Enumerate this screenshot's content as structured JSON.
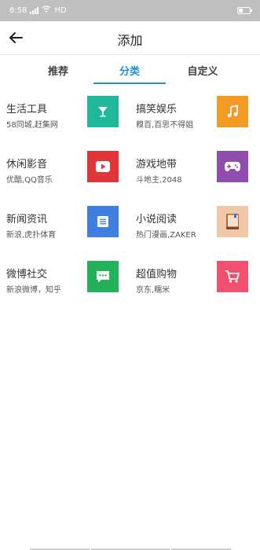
{
  "status": {
    "time": "8:58",
    "network": "HD"
  },
  "header": {
    "title": "添加"
  },
  "tabs": [
    {
      "label": "推荐",
      "active": false
    },
    {
      "label": "分类",
      "active": true
    },
    {
      "label": "自定义",
      "active": false
    }
  ],
  "colors": {
    "accent": "#1e8fd8"
  },
  "categories": [
    {
      "name": "生活工具",
      "desc": "58同城,赶集网",
      "icon": "cocktail-glass-icon",
      "color": "#1fb99a"
    },
    {
      "name": "搞笑娱乐",
      "desc": "糗百,百思不得姐",
      "icon": "music-note-icon",
      "color": "#f39a24"
    },
    {
      "name": "休闲影音",
      "desc": "优酷,QQ音乐",
      "icon": "play-icon",
      "color": "#e0363a"
    },
    {
      "name": "游戏地带",
      "desc": "斗地主,2048",
      "icon": "gamepad-icon",
      "color": "#8f4dae"
    },
    {
      "name": "新闻资讯",
      "desc": "新浪,虎扑体育",
      "icon": "news-list-icon",
      "color": "#3f7fe0"
    },
    {
      "name": "小说阅读",
      "desc": "热门漫画,ZAKER",
      "icon": "book-icon",
      "color": "#efc9a5"
    },
    {
      "name": "微博社交",
      "desc": "新浪微博，知乎",
      "icon": "chat-bubble-icon",
      "color": "#22b35a"
    },
    {
      "name": "超值购物",
      "desc": "京东,糯米",
      "icon": "cart-icon",
      "color": "#f0506e"
    }
  ]
}
